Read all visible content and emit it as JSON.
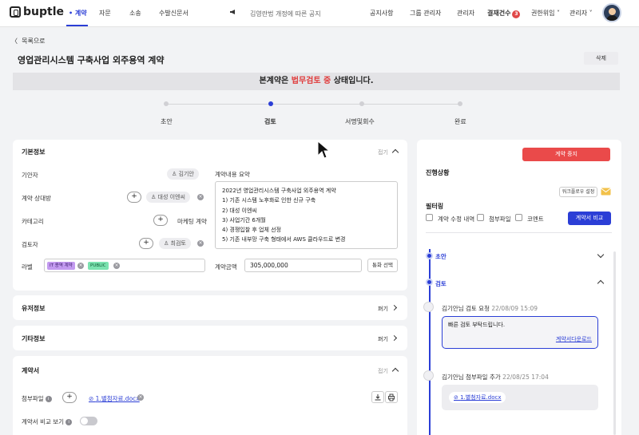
{
  "nav": {
    "logo": "buptle",
    "items": [
      "계약",
      "자문",
      "소송",
      "수발신문서"
    ],
    "notice": "김영란법 개정에 따른 공지",
    "right": [
      "공지사항",
      "그룹 관리자",
      "관리자",
      "결재건수",
      "권한위임",
      "관리자"
    ],
    "approval_count": "3"
  },
  "page": {
    "back_label": "목록으로",
    "title": "영업관리시스템 구축사업 외주용역 계약",
    "delete_label": "삭제",
    "status_prefix": "본계약은",
    "status_highlight": "법무검토 중",
    "status_suffix": "상태입니다."
  },
  "steps": [
    {
      "label": "초안",
      "active": false
    },
    {
      "label": "검토",
      "active": true
    },
    {
      "label": "서명및회수",
      "active": false
    },
    {
      "label": "완료",
      "active": false
    }
  ],
  "basic": {
    "title": "기본정보",
    "fold_label": "접기",
    "drafter_label": "기안자",
    "drafter": "김기안",
    "counterparty_label": "계약 상대방",
    "counterparty": "대성 이엔씨",
    "category_label": "카테고리",
    "category": "마케팅 계약",
    "reviewer_label": "검토자",
    "reviewer": "최검토",
    "label_label": "라벨",
    "tags": [
      "IT 용역 계약",
      "PUBLIC"
    ],
    "summary_label": "계약내용 요약",
    "summary_lines": [
      "2022년 영업관리시스템 구축사업 외주용역 계약",
      "1) 기존 시스템 노후화로 인한 신규 구축",
      "2) 대성 이엔씨",
      "3) 사업기간 6개월",
      "4) 경쟁입찰 후 업체 선정",
      "5) 기존 내부망 구축 형태에서 AWS 클라우드로 변경"
    ],
    "amount_label": "계약금액",
    "amount": "305,000,000",
    "currency_btn": "통화 선택"
  },
  "sections": [
    {
      "title": "유저정보",
      "action": "펴기"
    },
    {
      "title": "기타정보",
      "action": "펴기"
    }
  ],
  "contract": {
    "title": "계약서",
    "fold_label": "접기",
    "attach_label": "첨부파일",
    "file_name": "1.별첨자료.docx",
    "compare_label": "계약서 비교 보기"
  },
  "progress": {
    "stop_btn": "계약 중지",
    "title": "진행상황",
    "workflow_btn": "워크플로우 설정",
    "filter_title": "필터링",
    "filters": [
      "계약 수정 내역",
      "첨부파일",
      "코멘트"
    ],
    "compare_btn": "계약서 비교",
    "stage_draft": "초안",
    "stage_review": "검토",
    "event1_user": "김기안님 검토 요청",
    "event1_time": "22/08/09 15:09",
    "event1_comment": "빠른 검토 부탁드립니다.",
    "event1_link": "계약서다운로드",
    "event2_user": "김기안님 첨부파일 추가",
    "event2_time": "22/08/25 17:04",
    "event2_file": "1.별첨자료.docx"
  },
  "colors": {
    "accent": "#2b3ed6",
    "danger": "#ea4a4a"
  }
}
